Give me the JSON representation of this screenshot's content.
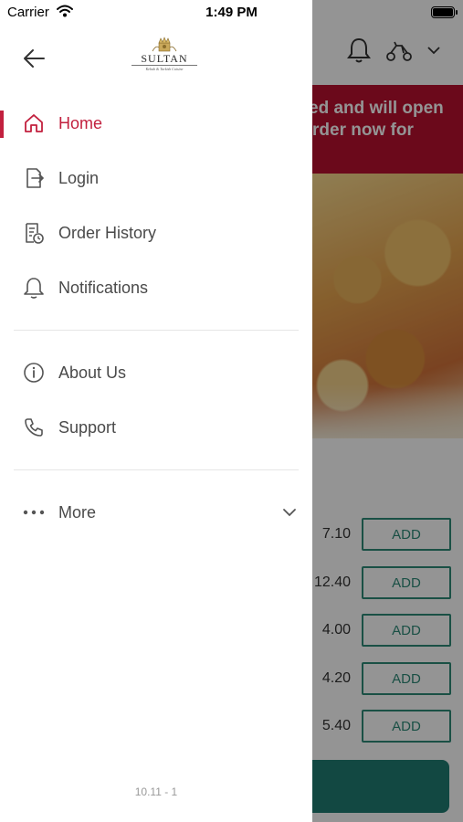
{
  "status_bar": {
    "carrier": "Carrier",
    "time": "1:49 PM"
  },
  "drawer": {
    "logo": {
      "name": "SULTAN",
      "tagline": "Kebab & Turkish Cuisine"
    },
    "menu_primary": [
      {
        "label": "Home",
        "icon": "home-icon",
        "active": true
      },
      {
        "label": "Login",
        "icon": "login-icon",
        "active": false
      },
      {
        "label": "Order History",
        "icon": "order-history-icon",
        "active": false
      },
      {
        "label": "Notifications",
        "icon": "bell-icon",
        "active": false
      }
    ],
    "menu_secondary": [
      {
        "label": "About Us",
        "icon": "info-icon"
      },
      {
        "label": "Support",
        "icon": "phone-icon"
      }
    ],
    "more": {
      "label": "More",
      "icon": "ellipsis-icon"
    },
    "version": "10.11 - 1"
  },
  "background": {
    "banner_line1": "ed and will open",
    "banner_line2": "rder now for",
    "items": [
      {
        "price": "7.10",
        "add_label": "ADD"
      },
      {
        "price": "12.40",
        "add_label": "ADD"
      },
      {
        "price": "4.00",
        "add_label": "ADD"
      },
      {
        "price": "4.20",
        "add_label": "ADD"
      },
      {
        "price": "5.40",
        "add_label": "ADD"
      }
    ]
  },
  "colors": {
    "accent": "#c2203e",
    "banner": "#b8102f",
    "teal": "#2e8a78"
  }
}
